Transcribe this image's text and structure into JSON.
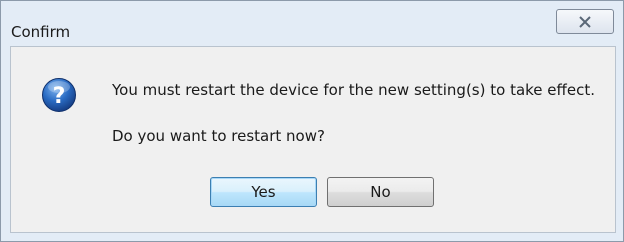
{
  "window": {
    "title": "Confirm"
  },
  "dialog": {
    "message": "You must restart the device for the new setting(s) to take effect.",
    "prompt": "Do you want to restart now?",
    "icon": "question-icon"
  },
  "buttons": {
    "yes_label": "Yes",
    "no_label": "No",
    "close_icon": "close-icon"
  },
  "colors": {
    "frame": "#e3ecf6",
    "content": "#f0f0f0",
    "icon_blue": "#1f5fb3",
    "default_button_border": "#3c7fb1"
  }
}
